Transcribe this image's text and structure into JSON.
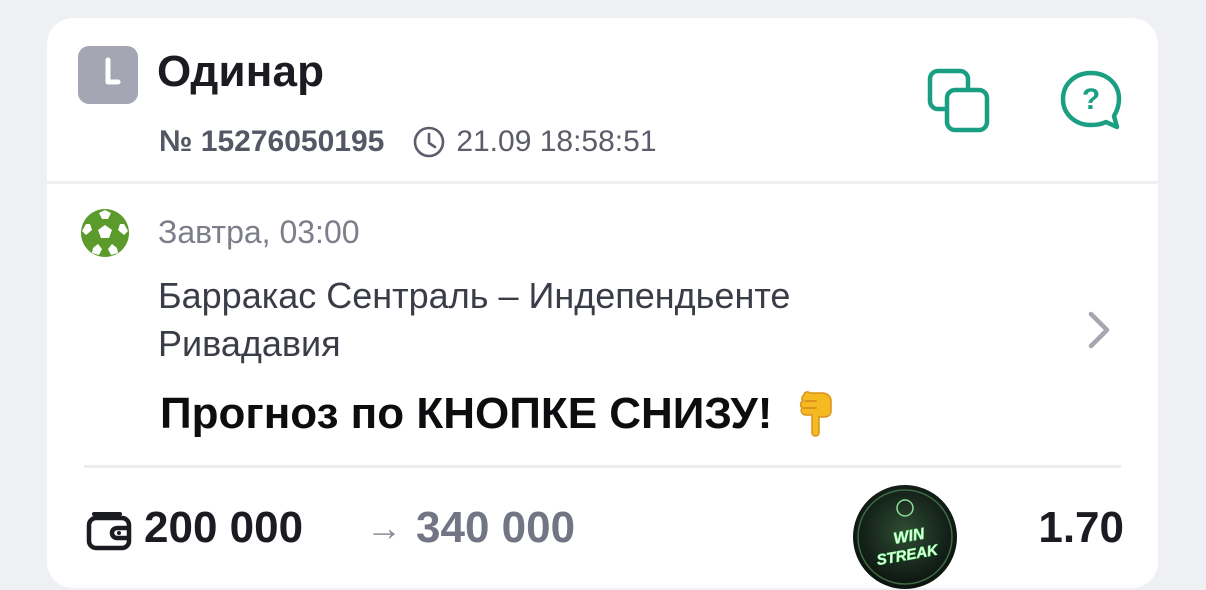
{
  "bet": {
    "type_title": "Одинар",
    "number": "№ 15276050195",
    "timestamp": "21.09 18:58:51"
  },
  "event": {
    "when": "Завтра, 03:00",
    "teams": "Барракас Сентраль – Индепендьенте Ривадавия",
    "forecast_text": "Прогноз по КНОПКЕ СНИЗУ!",
    "sport_icon": "soccer-ball-icon"
  },
  "stake": {
    "amount": "200 000",
    "arrow": "→",
    "potential_win": "340 000",
    "badge_text_line1": "WIN",
    "badge_text_line2": "STREAK",
    "odds": "1.70"
  },
  "icons": {
    "clock": "clock-icon",
    "copy": "copy-icon",
    "help": "help-bubble-icon",
    "chevron": "chevron-right-icon",
    "wallet": "wallet-icon",
    "hand": "pointing-down-hand-icon"
  },
  "colors": {
    "accent": "#1b9f82",
    "ball_green": "#5a9b2c",
    "badge_bg": "#1c2a1f",
    "badge_glow": "#7dff8a"
  }
}
